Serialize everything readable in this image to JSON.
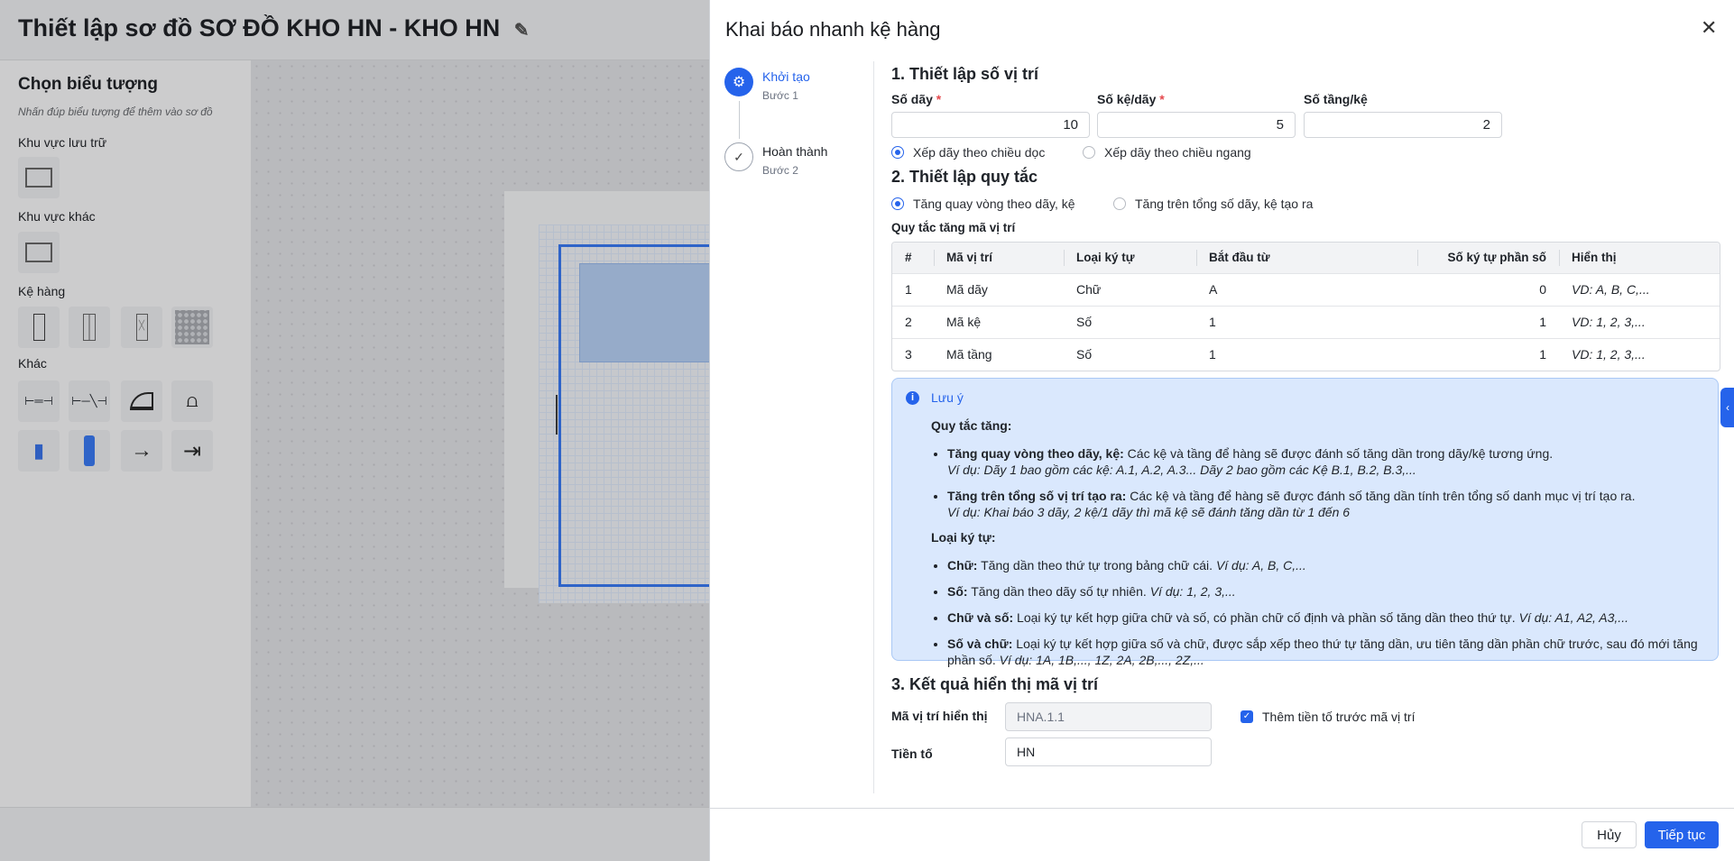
{
  "header": {
    "title": "Thiết lập sơ đồ SƠ ĐỒ KHO HN - KHO HN"
  },
  "left_panel": {
    "title": "Chọn biểu tượng",
    "hint": "Nhấn đúp biểu tượng để thêm vào sơ đồ",
    "sections": [
      "Khu vực lưu trữ",
      "Khu vực khác",
      "Kệ hàng",
      "Khác"
    ]
  },
  "dialog": {
    "title": "Khai báo nhanh kệ hàng",
    "steps": [
      {
        "label": "Khởi tạo",
        "sub": "Bước 1"
      },
      {
        "label": "Hoàn thành",
        "sub": "Bước 2"
      }
    ],
    "section1": {
      "heading": "1. Thiết lập số vị trí",
      "fields": [
        {
          "label": "Số dãy",
          "value": "10",
          "required": true
        },
        {
          "label": "Số kệ/dãy",
          "value": "5",
          "required": true
        },
        {
          "label": "Số tầng/kệ",
          "value": "2",
          "required": false
        }
      ],
      "required_mark": "*",
      "radios": [
        {
          "label": "Xếp dãy theo chiều dọc",
          "checked": true
        },
        {
          "label": "Xếp dãy theo chiều ngang",
          "checked": false
        }
      ]
    },
    "section2": {
      "heading": "2. Thiết lập quy tắc",
      "radios": [
        {
          "label": "Tăng quay vòng theo dãy, kệ",
          "checked": true
        },
        {
          "label": "Tăng trên tổng số dãy, kệ tạo ra",
          "checked": false
        }
      ],
      "table_label": "Quy tắc tăng mã vị trí",
      "columns": [
        "#",
        "Mã vị trí",
        "Loại ký tự",
        "Bắt đầu từ",
        "Số ký tự phần số",
        "Hiển thị"
      ],
      "rows": [
        [
          "1",
          "Mã dãy",
          "Chữ",
          "A",
          "0",
          "VD: A, B, C,..."
        ],
        [
          "2",
          "Mã kệ",
          "Số",
          "1",
          "1",
          "VD: 1, 2, 3,..."
        ],
        [
          "3",
          "Mã tầng",
          "Số",
          "1",
          "1",
          "VD: 1, 2, 3,..."
        ]
      ]
    },
    "note": {
      "title": "Lưu ý",
      "rules_heading": "Quy tắc tăng:",
      "rules": [
        {
          "bold": "Tăng quay vòng theo dãy, kệ:",
          "text": " Các kệ và tầng để hàng sẽ được đánh số tăng dần trong dãy/kệ tương ứng.",
          "example": "Ví dụ: Dãy 1 bao gồm các kệ: A.1, A.2, A.3... Dãy 2 bao gồm các Kệ B.1, B.2, B.3,..."
        },
        {
          "bold": "Tăng trên tổng số vị trí tạo ra:",
          "text": " Các kệ và tầng để hàng sẽ được đánh số tăng dần tính trên tổng số danh mục vị trí tạo ra.",
          "example": "Ví dụ: Khai báo 3 dãy, 2 kệ/1 dãy thì mã kệ sẽ đánh tăng dần từ 1 đến 6"
        }
      ],
      "types_heading": "Loại ký tự:",
      "types": [
        {
          "bold": "Chữ:",
          "text": " Tăng dần theo thứ tự trong bảng chữ cái. ",
          "example": "Ví dụ: A, B, C,..."
        },
        {
          "bold": "Số:",
          "text": " Tăng dần theo dãy số tự nhiên. ",
          "example": "Ví dụ: 1, 2, 3,..."
        },
        {
          "bold": "Chữ và số:",
          "text": " Loại ký tự kết hợp giữa chữ và số, có phần chữ cố định và phần số tăng dần theo thứ tự. ",
          "example": "Ví dụ: A1, A2, A3,..."
        },
        {
          "bold": "Số và chữ:",
          "text": " Loại ký tự kết hợp giữa số và chữ, được sắp xếp theo thứ tự tăng dần, ưu tiên tăng dần phần chữ trước, sau đó mới tăng phần số. ",
          "example": "Ví dụ: 1A, 1B,..., 1Z, 2A, 2B,..., 2Z,..."
        }
      ]
    },
    "section3": {
      "heading": "3. Kết quả hiển thị mã vị trí",
      "display_label": "Mã vị trí hiển thị",
      "display_value": "HNA.1.1",
      "prefix_checkbox": "Thêm tiền tố trước mã vị trí",
      "prefix_checked": true,
      "prefix_label": "Tiền tố",
      "prefix_value": "HN"
    },
    "buttons": {
      "cancel": "Hủy",
      "next": "Tiếp tục"
    }
  },
  "colors": {
    "primary": "#2563eb",
    "note_bg": "#dae8fd"
  }
}
